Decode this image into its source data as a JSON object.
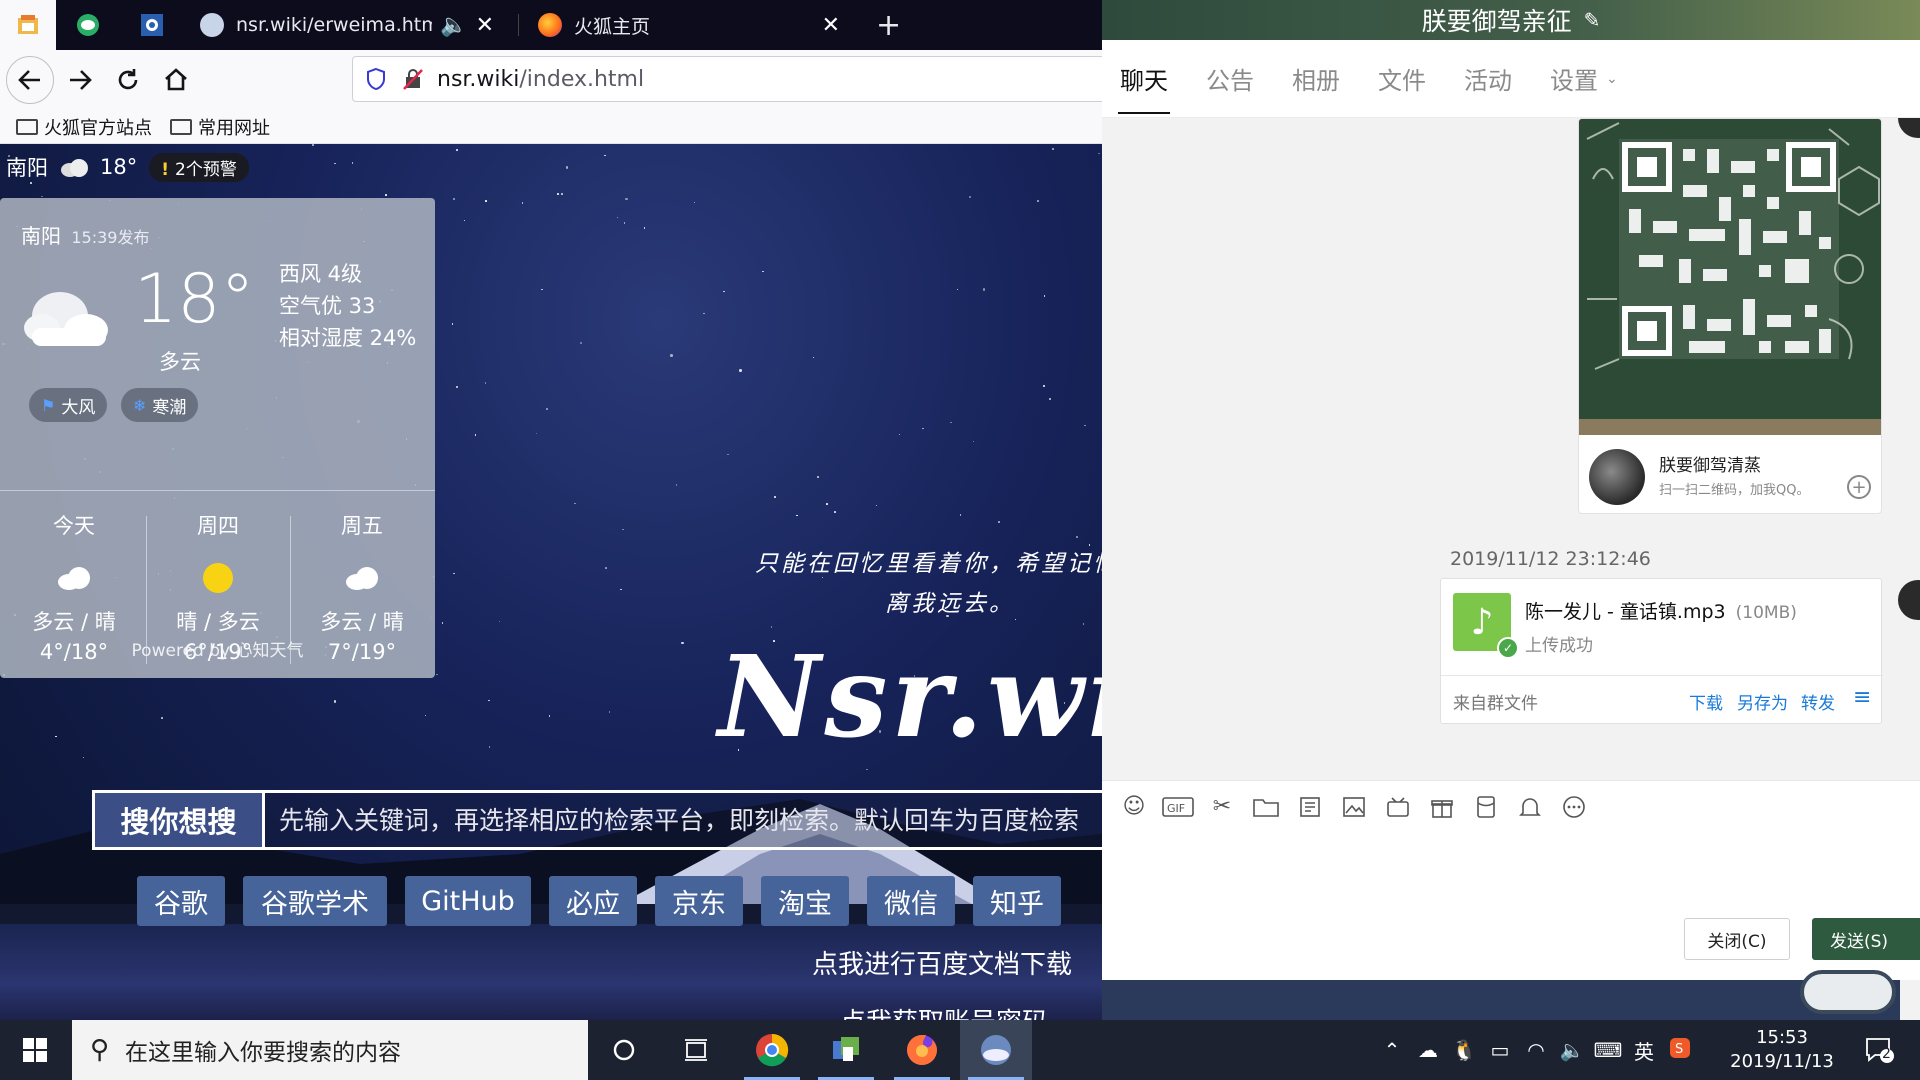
{
  "browser": {
    "tabs": [
      {
        "title": "nsr.wiki/erweima.html",
        "has_audio": true
      },
      {
        "title": "火狐主页"
      }
    ],
    "url_host": "nsr.wiki",
    "url_path": "/index.html",
    "bookmarks": [
      "火狐官方站点",
      "常用网址"
    ]
  },
  "weather_strip": {
    "city": "南阳",
    "temp": "18°",
    "warning": "2个预警"
  },
  "weather_card": {
    "city": "南阳",
    "published": "15:39发布",
    "temp": "18°",
    "condition": "多云",
    "wind": "西风 4级",
    "air": "空气优 33",
    "humidity": "相对湿度 24%",
    "alerts": [
      "大风",
      "寒潮"
    ],
    "forecast": [
      {
        "day": "今天",
        "icon": "cloud-icon",
        "cond": "多云 / 晴",
        "range": "4°/18°"
      },
      {
        "day": "周四",
        "icon": "sun-icon",
        "cond": "晴 / 多云",
        "range": "6°/19°"
      },
      {
        "day": "周五",
        "icon": "cloud-icon",
        "cond": "多云 / 晴",
        "range": "7°/19°"
      }
    ],
    "powered": "Powered by 心知天气"
  },
  "page": {
    "quote_line1": "只能在回忆里看着你，希望记忆中",
    "quote_line2": "离我远去。",
    "logo": "Nsr.wiki",
    "search_label": "搜你想搜",
    "search_placeholder": "先输入关键词，再选择相应的检索平台，即刻检索。默认回车为百度检索",
    "engines": [
      "谷歌",
      "谷歌学术",
      "GitHub",
      "必应",
      "京东",
      "淘宝",
      "微信",
      "知乎"
    ],
    "link1": "点我进行百度文档下载",
    "link2": "点我获取账号密码"
  },
  "chat": {
    "group_name": "朕要御驾亲征",
    "tabs": [
      "聊天",
      "公告",
      "相册",
      "文件",
      "活动",
      "设置"
    ],
    "qr_card": {
      "name": "朕要御驾清蒸",
      "hint": "扫一扫二维码，加我QQ。"
    },
    "message_time": "2019/11/12 23:12:46",
    "file": {
      "name": "陈一发儿 - 童话镇.mp3",
      "size": "(10MB)",
      "status": "上传成功",
      "source": "来自群文件",
      "actions": [
        "下载",
        "另存为",
        "转发"
      ]
    },
    "close_label": "关闭(C)",
    "send_label": "发送(S)"
  },
  "taskbar": {
    "search_placeholder": "在这里输入你要搜索的内容",
    "ime": "英",
    "time": "15:53",
    "date": "2019/11/13",
    "notif_count": "2"
  },
  "colors": {
    "engine_btn": "#46649a",
    "search_label_bg": "#3b4f86",
    "send_btn": "#2e5a40",
    "link_blue": "#1a7ad8"
  }
}
